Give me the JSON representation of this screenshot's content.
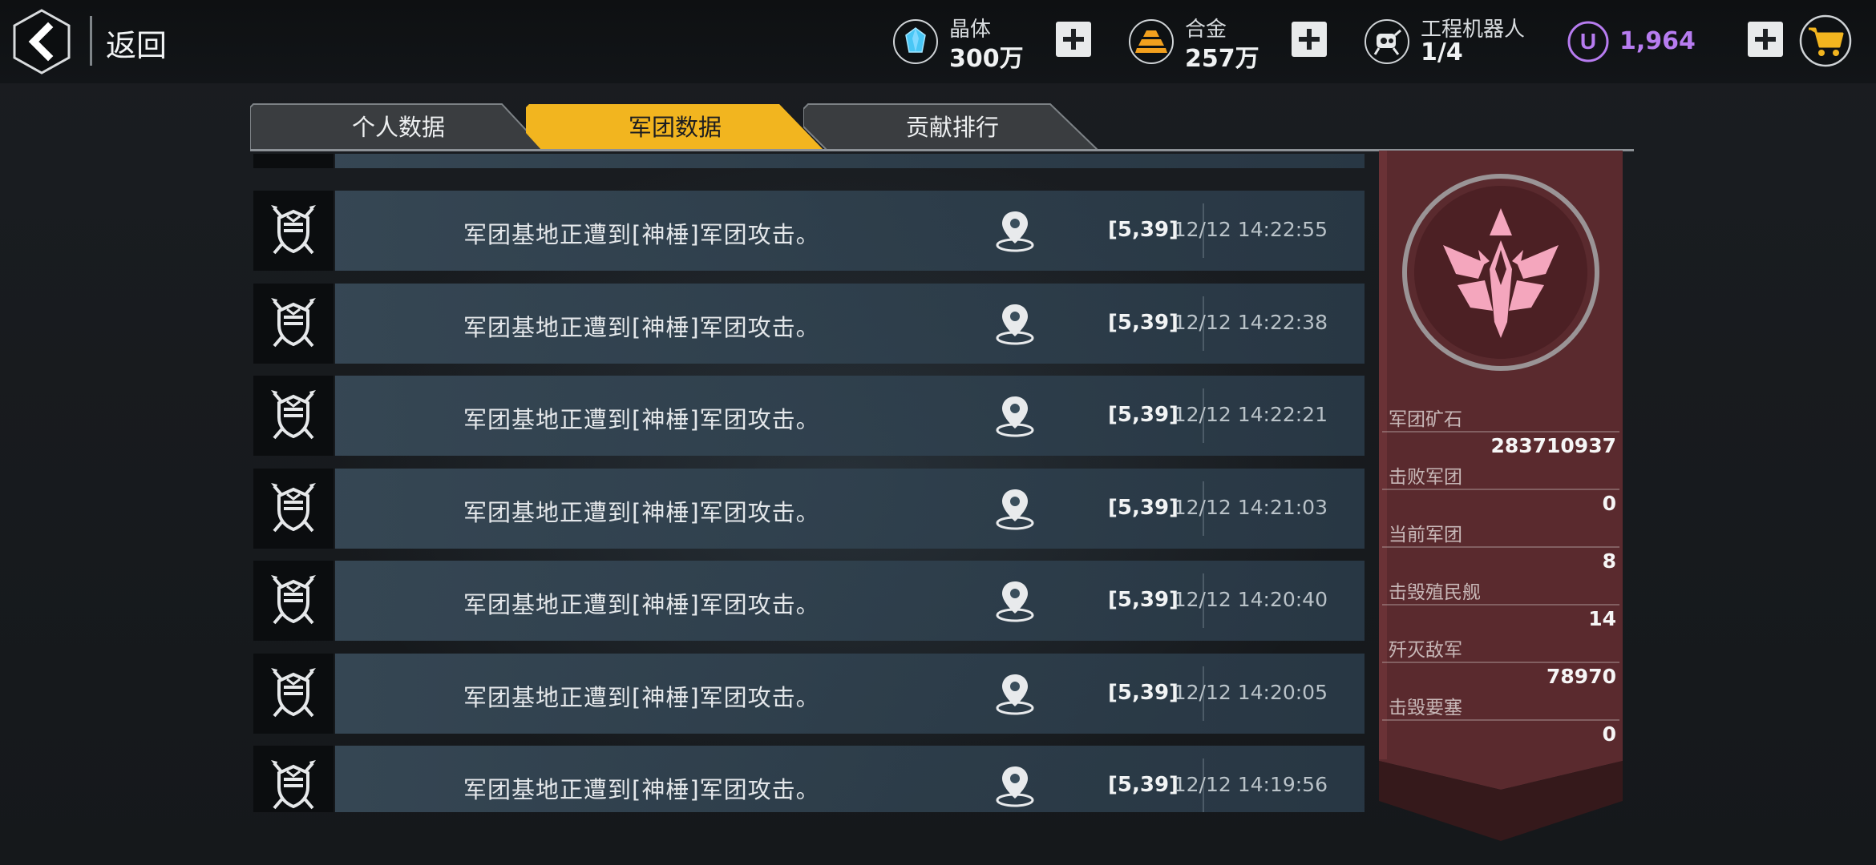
{
  "header": {
    "back_label": "返回",
    "resources": [
      {
        "name": "晶体",
        "value": "300万",
        "icon": "crystal-icon"
      },
      {
        "name": "合金",
        "value": "257万",
        "icon": "alloy-icon"
      },
      {
        "name": "工程机器人",
        "value": "1/4",
        "icon": "robot-icon"
      }
    ],
    "premium": {
      "icon_letter": "U",
      "value": "1,964"
    }
  },
  "tabs": [
    {
      "label": "个人数据",
      "active": false
    },
    {
      "label": "军团数据",
      "active": true
    },
    {
      "label": "贡献排行",
      "active": false
    }
  ],
  "events": [
    {
      "message": "军团基地正遭到[神棰]军团攻击。",
      "coords": "[5,39]",
      "time": "12/12 14:22:55"
    },
    {
      "message": "军团基地正遭到[神棰]军团攻击。",
      "coords": "[5,39]",
      "time": "12/12 14:22:38"
    },
    {
      "message": "军团基地正遭到[神棰]军团攻击。",
      "coords": "[5,39]",
      "time": "12/12 14:22:21"
    },
    {
      "message": "军团基地正遭到[神棰]军团攻击。",
      "coords": "[5,39]",
      "time": "12/12 14:21:03"
    },
    {
      "message": "军团基地正遭到[神棰]军团攻击。",
      "coords": "[5,39]",
      "time": "12/12 14:20:40"
    },
    {
      "message": "军团基地正遭到[神棰]军团攻击。",
      "coords": "[5,39]",
      "time": "12/12 14:20:05"
    },
    {
      "message": "军团基地正遭到[神棰]军团攻击。",
      "coords": "[5,39]",
      "time": "12/12 14:19:56"
    }
  ],
  "panel": {
    "stats": [
      {
        "label": "军团矿石",
        "value": "283710937"
      },
      {
        "label": "击败军团",
        "value": "0"
      },
      {
        "label": "当前军团",
        "value": "8"
      },
      {
        "label": "击毁殖民舰",
        "value": "14"
      },
      {
        "label": "歼灭敌军",
        "value": "78970"
      },
      {
        "label": "击毁要塞",
        "value": "0"
      }
    ]
  },
  "colors": {
    "accent_tab": "#f2b51f",
    "premium": "#b77cf0",
    "panel": "#5a2a2e",
    "emblem": "#f4a6bd"
  }
}
